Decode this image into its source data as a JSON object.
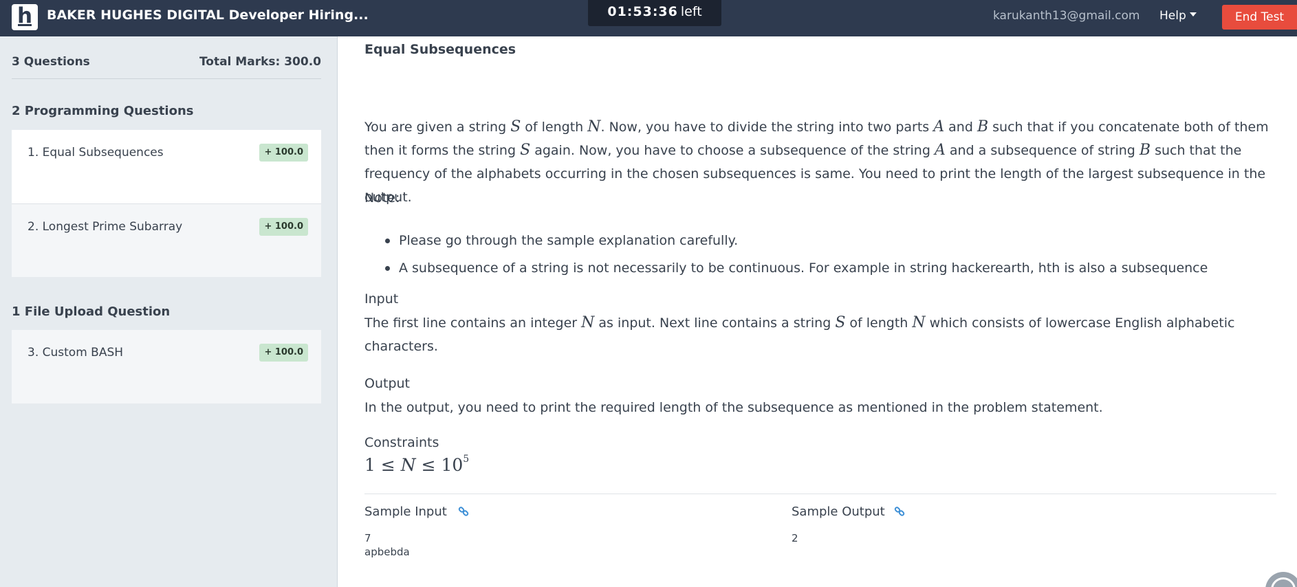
{
  "header": {
    "logo_letter": "h",
    "brand": "BAKER HUGHES DIGITAL Developer Hiring...",
    "timer_value": "01:53:36",
    "timer_suffix": "left",
    "email": "karukanth13@gmail.com",
    "help_label": "Help",
    "end_test_label": "End Test"
  },
  "sidebar": {
    "question_count": "3 Questions",
    "total_marks": "Total Marks: 300.0",
    "sections": [
      {
        "title": "2 Programming Questions",
        "questions": [
          {
            "label": "1. Equal Subsequences",
            "marks": "+ 100.0",
            "active": true
          },
          {
            "label": "2. Longest Prime Subarray",
            "marks": "+ 100.0",
            "active": false
          }
        ]
      },
      {
        "title": "1 File Upload Question",
        "questions": [
          {
            "label": "3. Custom BASH",
            "marks": "+ 100.0",
            "active": false
          }
        ]
      }
    ]
  },
  "problem": {
    "title": "Equal Subsequences",
    "statement": {
      "t1": "You are given a string ",
      "v_s": "S",
      "t2": " of length ",
      "v_n": "N",
      "t3": ". Now, you have to divide the string into two parts ",
      "v_a": "A",
      "t4": " and ",
      "v_b": "B",
      "t5": " such that if you concatenate both of them then it forms the string ",
      "t6": " again. Now, you have to choose a subsequence of the string ",
      "t7": " and a subsequence of string ",
      "t8": " such that the frequency of the alphabets occurring in the chosen subsequences is same. You need to print the length of the largest subsequence in the output."
    },
    "note_heading": "Note:",
    "notes": [
      "Please go through the sample explanation carefully.",
      "A subsequence of a string is not necessarily to be continuous. For example in string hackerearth, hth is also a subsequence"
    ],
    "input_heading": "Input",
    "input": {
      "t1": "The first line contains an integer ",
      "t2": " as input. Next line contains a string ",
      "t3": " of length ",
      "t4": " which consists of lowercase English alphabetic characters."
    },
    "output_heading": "Output",
    "output_text": "In the output, you need to print the required length of the subsequence as mentioned in the problem statement.",
    "constraints_heading": "Constraints",
    "constraint": {
      "lhs": "1 ≤ ",
      "var": "N",
      "mid": " ≤ 10",
      "exp": "5"
    },
    "sample_input_label": "Sample Input",
    "sample_output_label": "Sample Output",
    "sample_input": "7\napbebda",
    "sample_output": "2"
  },
  "colors": {
    "header_bg": "#2e3a4f",
    "end_test_bg": "#e84c3d",
    "badge_bg": "#c9e6cf",
    "link_blue": "#3d8fd6"
  }
}
